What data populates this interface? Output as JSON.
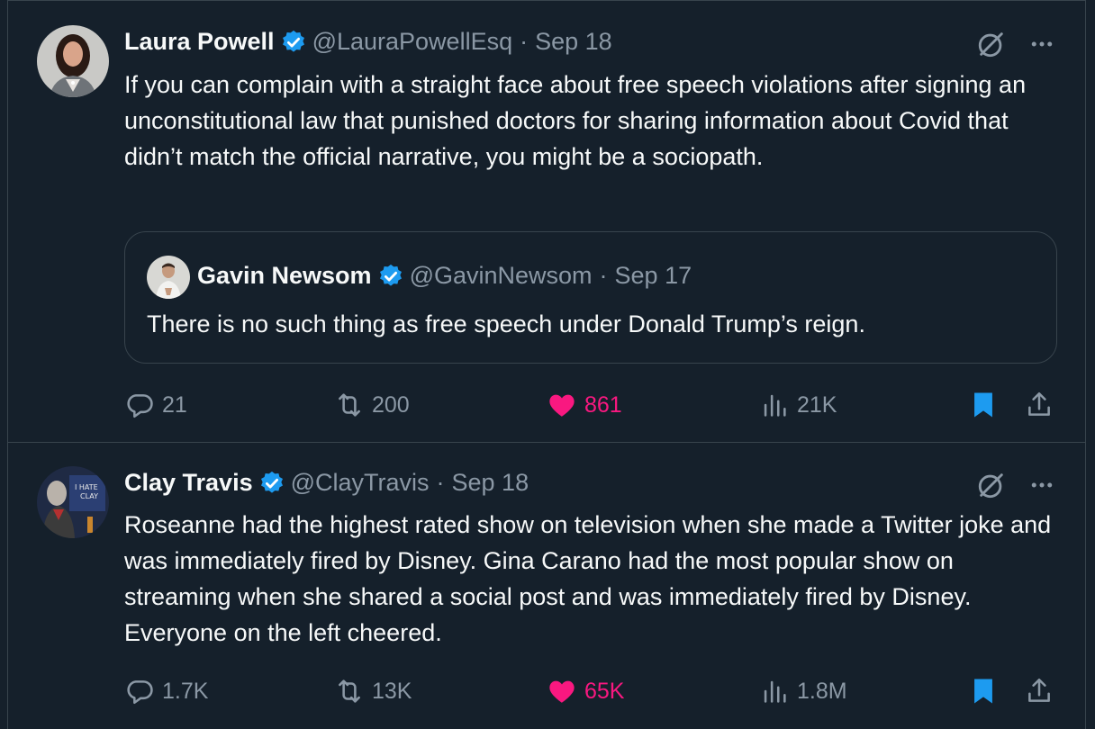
{
  "tweets": [
    {
      "name": "Laura Powell",
      "handle": "@LauraPowellEsq",
      "separator": "·",
      "date": "Sep 18",
      "text": "If you can complain with a straight face about free speech violations after signing an unconstitutional law that punished doctors for sharing information about Covid that didn’t match the official narrative, you might be a sociopath.",
      "quote": {
        "name": "Gavin Newsom",
        "handle": "@GavinNewsom",
        "separator": "·",
        "date": "Sep 17",
        "text": "There is no such thing as free speech under Donald Trump’s reign."
      },
      "stats": {
        "replies": "21",
        "reposts": "200",
        "likes": "861",
        "views": "21K"
      }
    },
    {
      "name": "Clay Travis",
      "handle": "@ClayTravis",
      "separator": "·",
      "date": "Sep 18",
      "text": "Roseanne had the highest rated show on television when she made a Twitter joke and was immediately fired by Disney. Gina Carano had the most popular show on streaming when she shared a social post and was immediately fired by Disney. Everyone on the left cheered.",
      "stats": {
        "replies": "1.7K",
        "reposts": "13K",
        "likes": "65K",
        "views": "1.8M"
      }
    }
  ],
  "colors": {
    "background": "#15202b",
    "border": "#38444d",
    "text": "#f7f9f9",
    "muted": "#8b98a5",
    "verified": "#1d9bf0",
    "like": "#f91880",
    "bookmark": "#1d9bf0"
  },
  "icons": [
    "verified-badge-icon",
    "grok-icon",
    "more-icon",
    "reply-icon",
    "repost-icon",
    "like-icon",
    "views-icon",
    "bookmark-icon",
    "share-icon"
  ]
}
